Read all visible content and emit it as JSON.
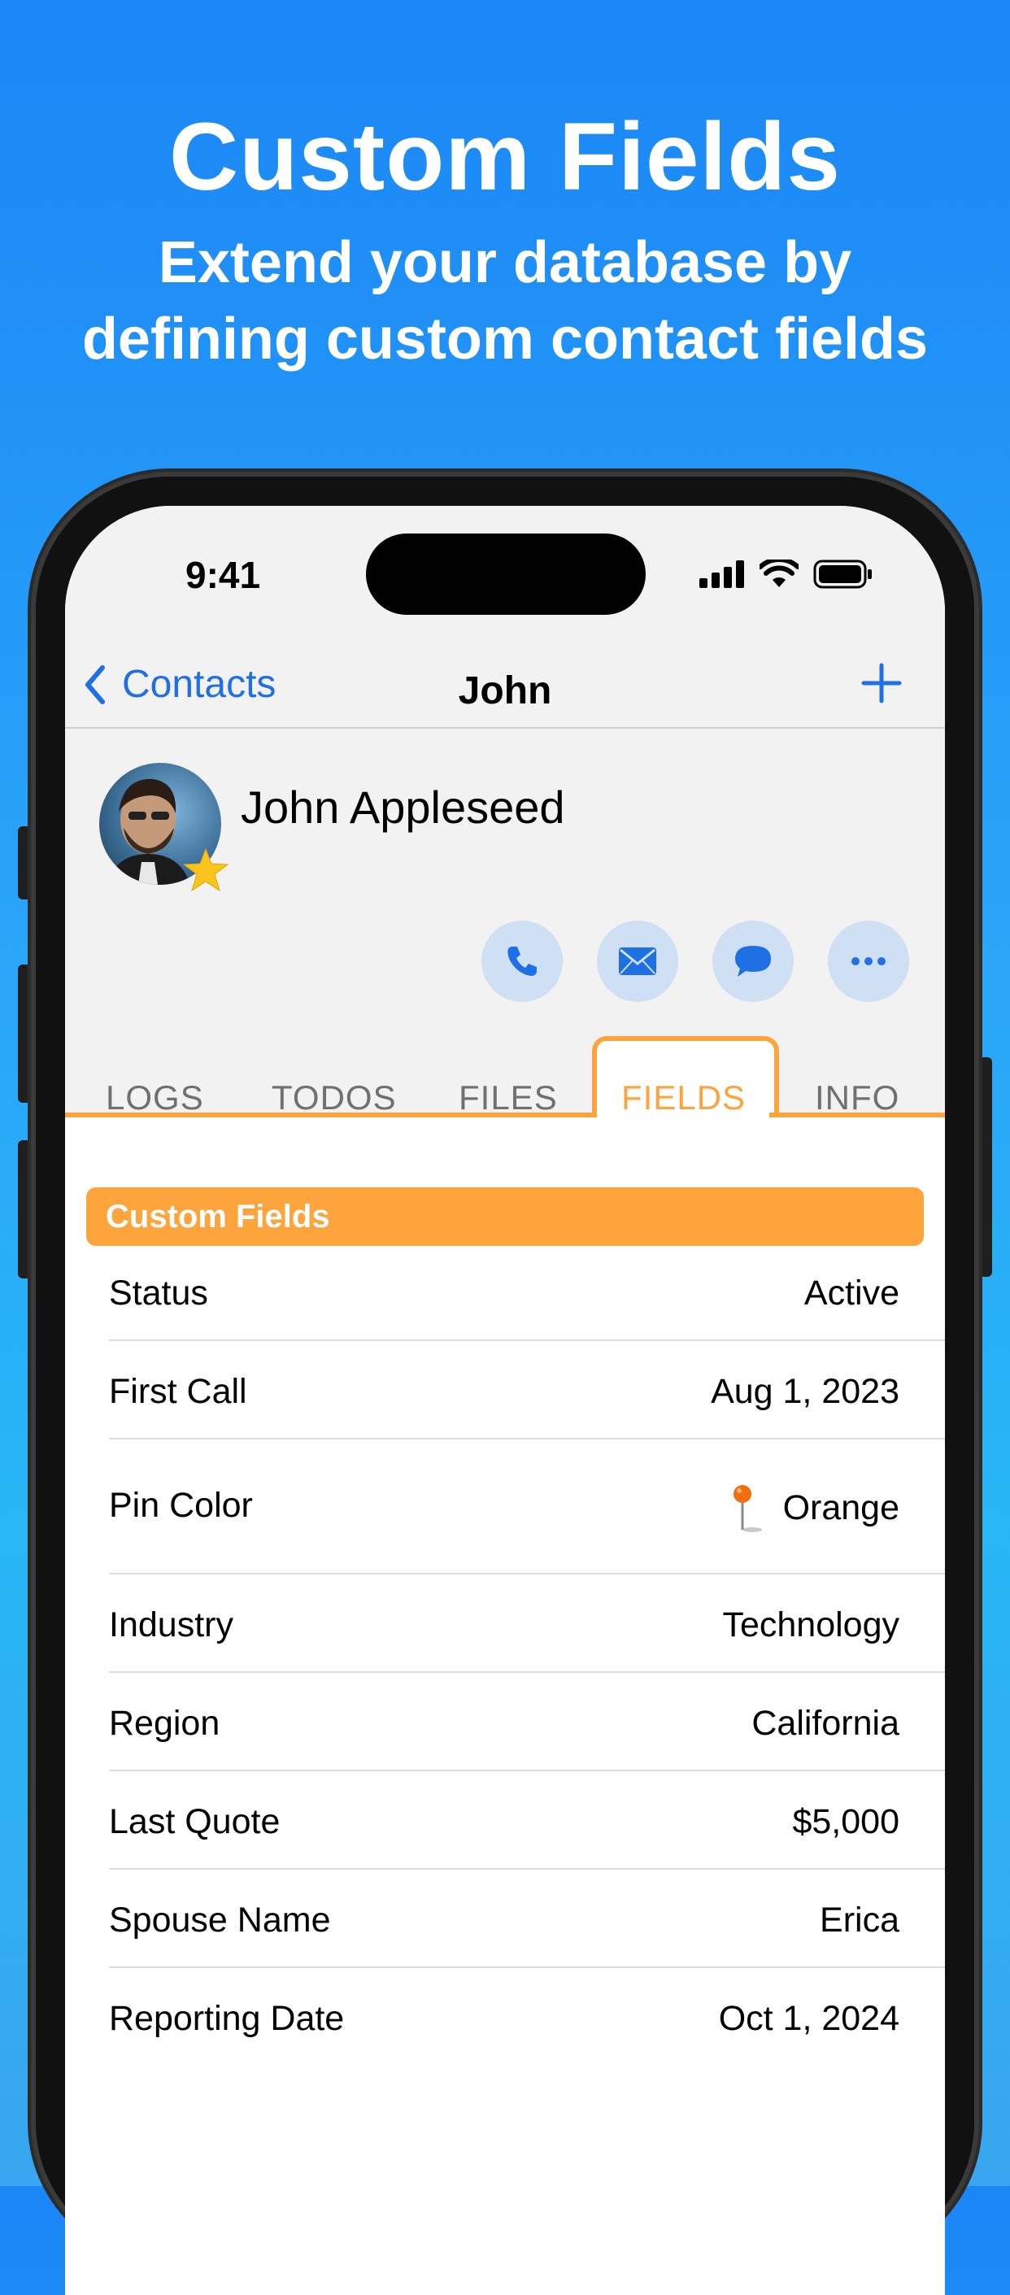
{
  "headline": {
    "title": "Custom Fields",
    "subtitle_line1": "Extend your database by",
    "subtitle_line2": "defining custom contact fields"
  },
  "status_bar": {
    "time": "9:41"
  },
  "nav": {
    "back_label": "Contacts",
    "title": "John",
    "add_icon": "plus-icon"
  },
  "contact": {
    "name": "John Appleseed",
    "favorite": true
  },
  "actions": [
    {
      "name": "call",
      "icon": "phone-icon"
    },
    {
      "name": "email",
      "icon": "envelope-icon"
    },
    {
      "name": "message",
      "icon": "chat-bubble-icon"
    },
    {
      "name": "more",
      "icon": "ellipsis-icon"
    }
  ],
  "tabs": [
    "LOGS",
    "TODOS",
    "FILES",
    "FIELDS",
    "INFO"
  ],
  "active_tab": "FIELDS",
  "section_title": "Custom Fields",
  "fields": [
    {
      "label": "Status",
      "value": "Active"
    },
    {
      "label": "First Call",
      "value": "Aug 1, 2023"
    },
    {
      "label": "Pin Color",
      "value": "Orange",
      "icon": "pin-icon"
    },
    {
      "label": "Industry",
      "value": "Technology"
    },
    {
      "label": "Region",
      "value": "California"
    },
    {
      "label": "Last Quote",
      "value": "$5,000"
    },
    {
      "label": "Spouse Name",
      "value": "Erica"
    },
    {
      "label": "Reporting Date",
      "value": "Oct 1, 2024"
    }
  ],
  "colors": {
    "accent": "#fda53c",
    "link": "#1f6fe5",
    "background": "#1b86f6"
  }
}
